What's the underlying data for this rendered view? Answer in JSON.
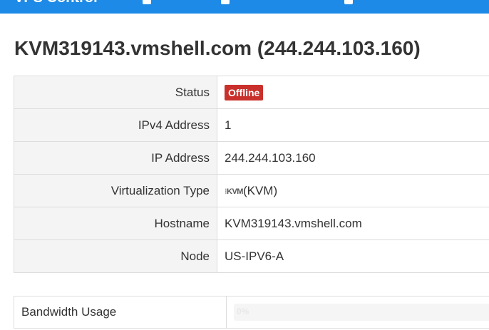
{
  "header": {
    "brand": "VPS Control"
  },
  "page_title": "KVM319143.vmshell.com (244.244.103.160)",
  "details": {
    "status_label": "Status",
    "status_value": "Offline",
    "status_color": "#c9302c",
    "ipv4_label": "IPv4 Address",
    "ipv4_value": "1",
    "ip_label": "IP Address",
    "ip_value": "244.244.103.160",
    "virt_label": "Virtualization Type",
    "virt_logo_text": "KVM",
    "virt_value": "(KVM)",
    "hostname_label": "Hostname",
    "hostname_value": "KVM319143.vmshell.com",
    "node_label": "Node",
    "node_value": "US-IPV6-A"
  },
  "bandwidth": {
    "label": "Bandwidth Usage",
    "percent_text": "0%",
    "fraction": 0
  }
}
